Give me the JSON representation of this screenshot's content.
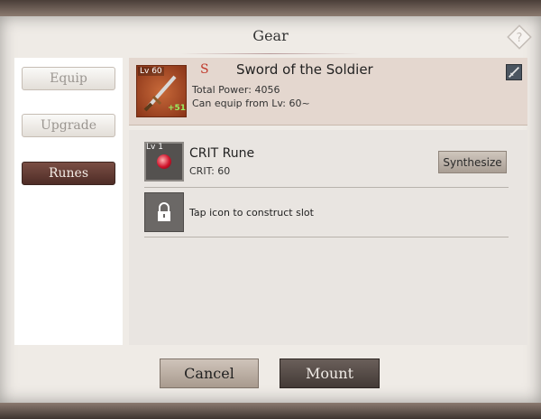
{
  "dialog": {
    "title": "Gear"
  },
  "sidebar": {
    "tabs": [
      {
        "label": "Equip",
        "active": false
      },
      {
        "label": "Upgrade",
        "active": false
      },
      {
        "label": "Runes",
        "active": true
      }
    ]
  },
  "item": {
    "level": "Lv 60",
    "grade": "S",
    "name": "Sword of the Soldier",
    "enhance": "+51",
    "total_power": "Total Power: 4056",
    "equip_level": "Can equip from Lv: 60~",
    "icon": "sword-icon"
  },
  "runes": {
    "slots": [
      {
        "level": "Lv 1",
        "name": "CRIT Rune",
        "stat": "CRIT: 60",
        "action": "Synthesize",
        "icon": "red-gem-icon"
      },
      {
        "text": "Tap icon to construct slot",
        "icon": "lock-icon"
      }
    ]
  },
  "buttons": {
    "cancel": "Cancel",
    "mount": "Mount"
  },
  "colors": {
    "active_tab": "#5e362f",
    "grade": "#c0392b",
    "enhance": "#9bef60"
  }
}
